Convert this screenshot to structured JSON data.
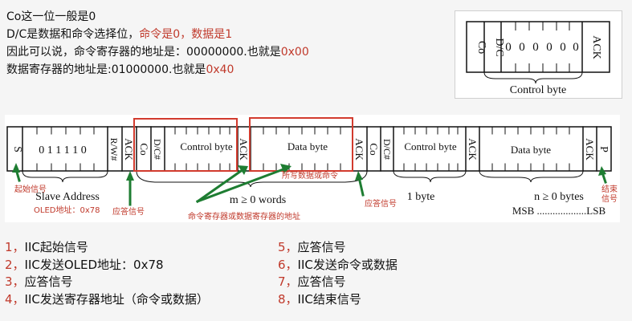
{
  "intro": {
    "line1": "Co这一位一般是0",
    "line2_a": "D/C是数据和命令选择位，",
    "line2_b": "命令是0，数据是1",
    "line3_a": "因此可以说，命令寄存器的地址是：00000000.也就是",
    "line3_b": "0x00",
    "line4_a": "数据寄存器的地址是:01000000.也就是",
    "line4_b": "0x40"
  },
  "control_byte": {
    "cells": [
      "Co",
      "D/C",
      "0",
      "0",
      "0",
      "0",
      "0",
      "0",
      "ACK"
    ],
    "caption": "Control byte"
  },
  "frame": {
    "start": "S",
    "addr_bits": "0 1 1 1 1 0",
    "rw": "R/W#",
    "ack": "ACK",
    "co": "Co",
    "dc": "D/C#",
    "control_byte": "Control byte",
    "data_byte": "Data byte",
    "stop": "P",
    "slave_address": "Slave Address",
    "m_words": "m ≥ 0 words",
    "one_byte": "1 byte",
    "n_bytes": "n ≥ 0 bytes",
    "msb_lsb": "MSB ...................LSB"
  },
  "annotations": {
    "start_signal": "起始信号",
    "oled_addr": "OLED地址：0x78",
    "ack_signal_1": "应答信号",
    "ack_signal_2": "应答信号",
    "reg_addr": "命令寄存器或数据寄存器的地址",
    "written_data": "所写数据或命令",
    "end_signal_1": "结束",
    "end_signal_2": "信号"
  },
  "steps_left": [
    {
      "num": "1，",
      "text": "IIC起始信号"
    },
    {
      "num": "2，",
      "text": "IIC发送OLED地址：0x78"
    },
    {
      "num": "3，",
      "text": "应答信号"
    },
    {
      "num": "4，",
      "text": "IIC发送寄存器地址（命令或数据）"
    }
  ],
  "steps_right": [
    {
      "num": "5，",
      "text": "应答信号"
    },
    {
      "num": "6，",
      "text": "IIC发送命令或数据"
    },
    {
      "num": "7，",
      "text": "应答信号"
    },
    {
      "num": "8，",
      "text": "IIC结束信号"
    }
  ],
  "colors": {
    "red": "#c0392b",
    "green": "#1e7d32",
    "box_red": "#d23b2e"
  }
}
